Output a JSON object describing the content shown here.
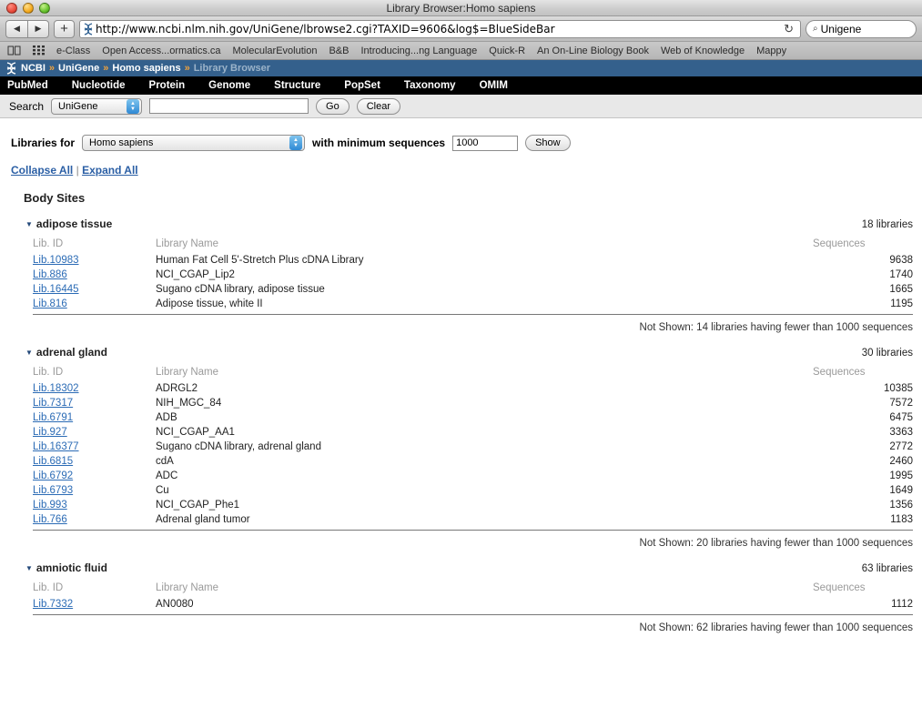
{
  "window": {
    "title": "Library Browser:Homo sapiens"
  },
  "toolbar": {
    "back_glyph": "◀",
    "forward_glyph": "▶",
    "add_tab_glyph": "+",
    "url": "http://www.ncbi.nlm.nih.gov/UniGene/lbrowse2.cgi?TAXID=9606&log$=BlueSideBar",
    "reload_glyph": "↻",
    "search_engine_glyph": "⌕",
    "search_value": "Unigene"
  },
  "bookmarks": {
    "items": [
      "e-Class",
      "Open Access...ormatics.ca",
      "MolecularEvolution",
      "B&B",
      "Introducing...ng Language",
      "Quick-R",
      "An On-Line Biology Book",
      "Web of Knowledge",
      "Mappy"
    ]
  },
  "breadcrumb": {
    "separator": "»",
    "items": [
      {
        "label": "NCBI",
        "current": false
      },
      {
        "label": "UniGene",
        "current": false
      },
      {
        "label": "Homo sapiens",
        "current": false
      },
      {
        "label": "Library Browser",
        "current": true
      }
    ]
  },
  "navbar": {
    "items": [
      "PubMed",
      "Nucleotide",
      "Protein",
      "Genome",
      "Structure",
      "PopSet",
      "Taxonomy",
      "OMIM"
    ]
  },
  "search_strip": {
    "label": "Search",
    "database_selected": "UniGene",
    "query_value": "",
    "go_label": "Go",
    "clear_label": "Clear"
  },
  "filter_strip": {
    "label": "Libraries for",
    "organism_selected": "Homo sapiens",
    "min_label": "with minimum sequences",
    "min_value": "1000",
    "show_label": "Show"
  },
  "toggles": {
    "collapse_all": "Collapse All",
    "pipe": "|",
    "expand_all": "Expand All"
  },
  "section": {
    "title": "Body Sites"
  },
  "columns": {
    "id": "Lib. ID",
    "name": "Library Name",
    "sequences": "Sequences"
  },
  "colors": {
    "link": "#2b6bb5",
    "ncbi_blue": "#34608c",
    "breadcrumb_sep": "#f2a33c",
    "header_gray": "#9a9a9a"
  },
  "groups": [
    {
      "name": "adipose tissue",
      "count": "18 libraries",
      "triangle": "▼",
      "rows": [
        {
          "id": "Lib.10983",
          "name": "Human Fat Cell 5'-Stretch Plus cDNA Library",
          "sequences": "9638"
        },
        {
          "id": "Lib.886",
          "name": "NCI_CGAP_Lip2",
          "sequences": "1740"
        },
        {
          "id": "Lib.16445",
          "name": "Sugano cDNA library, adipose tissue",
          "sequences": "1665"
        },
        {
          "id": "Lib.816",
          "name": "Adipose tissue, white II",
          "sequences": "1195"
        }
      ],
      "not_shown": "Not Shown: 14 libraries having fewer than 1000 sequences"
    },
    {
      "name": "adrenal gland",
      "count": "30 libraries",
      "triangle": "▼",
      "rows": [
        {
          "id": "Lib.18302",
          "name": "ADRGL2",
          "sequences": "10385"
        },
        {
          "id": "Lib.7317",
          "name": "NIH_MGC_84",
          "sequences": "7572"
        },
        {
          "id": "Lib.6791",
          "name": "ADB",
          "sequences": "6475"
        },
        {
          "id": "Lib.927",
          "name": "NCI_CGAP_AA1",
          "sequences": "3363"
        },
        {
          "id": "Lib.16377",
          "name": "Sugano cDNA library, adrenal gland",
          "sequences": "2772"
        },
        {
          "id": "Lib.6815",
          "name": "cdA",
          "sequences": "2460"
        },
        {
          "id": "Lib.6792",
          "name": "ADC",
          "sequences": "1995"
        },
        {
          "id": "Lib.6793",
          "name": "Cu",
          "sequences": "1649"
        },
        {
          "id": "Lib.993",
          "name": "NCI_CGAP_Phe1",
          "sequences": "1356"
        },
        {
          "id": "Lib.766",
          "name": "Adrenal gland tumor",
          "sequences": "1183"
        }
      ],
      "not_shown": "Not Shown: 20 libraries having fewer than 1000 sequences"
    },
    {
      "name": "amniotic fluid",
      "count": "63 libraries",
      "triangle": "▼",
      "rows": [
        {
          "id": "Lib.7332",
          "name": "AN0080",
          "sequences": "1112"
        }
      ],
      "not_shown": "Not Shown: 62 libraries having fewer than 1000 sequences"
    }
  ]
}
